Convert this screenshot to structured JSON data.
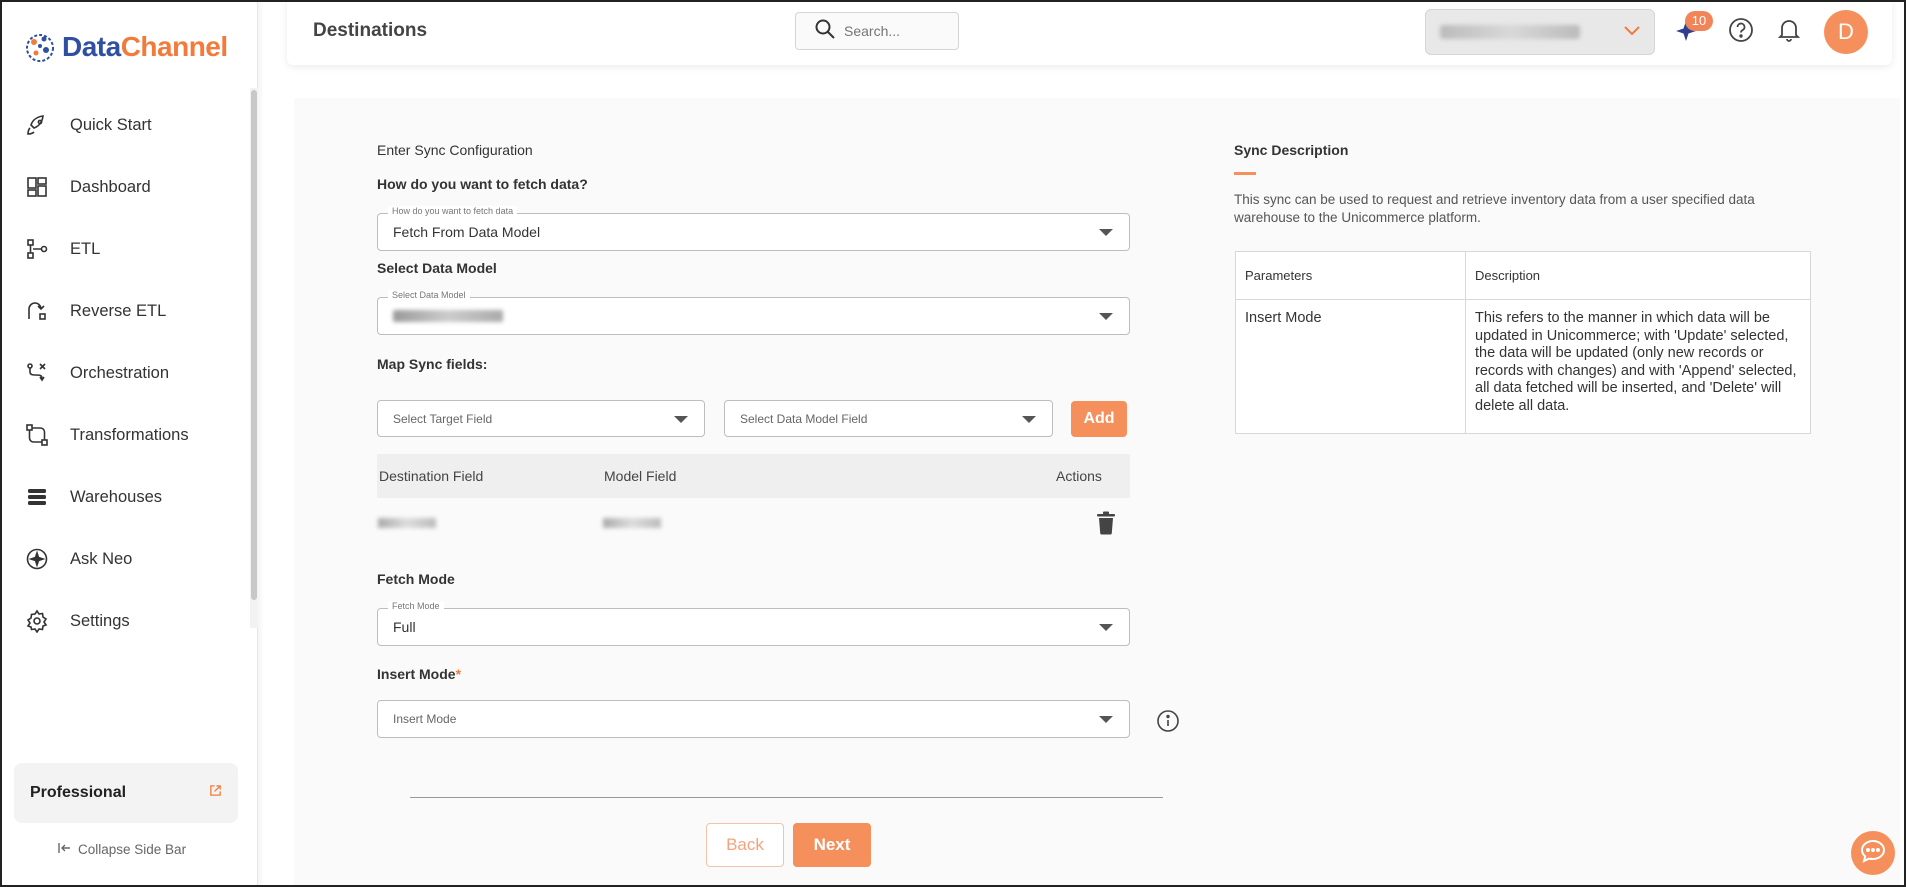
{
  "brand": {
    "logo_part1": "Data",
    "logo_part2": "Channel",
    "logo_blue": "#2f4fa2",
    "logo_orange": "#f27b3c"
  },
  "sidebar": {
    "items": [
      {
        "label": "Quick Start",
        "icon": "rocket-icon"
      },
      {
        "label": "Dashboard",
        "icon": "dashboard-icon"
      },
      {
        "label": "ETL",
        "icon": "etl-icon"
      },
      {
        "label": "Reverse ETL",
        "icon": "reverse-etl-icon"
      },
      {
        "label": "Orchestration",
        "icon": "orchestration-icon"
      },
      {
        "label": "Transformations",
        "icon": "transformations-icon"
      },
      {
        "label": "Warehouses",
        "icon": "warehouses-icon"
      },
      {
        "label": "Ask Neo",
        "icon": "ask-neo-icon"
      },
      {
        "label": "Settings",
        "icon": "gear-icon"
      }
    ],
    "plan": "Professional",
    "collapse_label": "Collapse Side Bar"
  },
  "header": {
    "title": "Destinations",
    "search_placeholder": "Search...",
    "notification_count": "10",
    "avatar_initial": "D"
  },
  "form": {
    "section_title": "Enter Sync Configuration",
    "fetch_question": "How do you want to fetch data?",
    "fetch_float": "How do you want to fetch data",
    "fetch_value": "Fetch From Data Model",
    "data_model_label": "Select Data Model",
    "data_model_float": "Select Data Model",
    "map_label": "Map Sync fields:",
    "target_placeholder": "Select Target Field",
    "model_placeholder": "Select Data Model Field",
    "add_label": "Add",
    "map_columns": {
      "destination": "Destination Field",
      "model": "Model Field",
      "actions": "Actions"
    },
    "fetch_mode_label": "Fetch Mode",
    "fetch_mode_float": "Fetch Mode",
    "fetch_mode_value": "Full",
    "insert_mode_label": "Insert Mode",
    "insert_mode_required": "*",
    "insert_mode_placeholder": "Insert Mode",
    "back_label": "Back",
    "next_label": "Next"
  },
  "description": {
    "title": "Sync Description",
    "text": "This sync can be used to request and retrieve inventory data from a user specified data warehouse to the Unicommerce platform.",
    "table_headers": {
      "parameters": "Parameters",
      "description": "Description"
    },
    "rows": [
      {
        "param": "Insert Mode",
        "desc": "This refers to the manner in which data will be updated in Unicommerce; with 'Update' selected, the data will be updated (only new records or records with changes) and with 'Append' selected, all data fetched will be inserted, and 'Delete' will delete all data."
      }
    ]
  },
  "colors": {
    "accent": "#f58f5b"
  }
}
